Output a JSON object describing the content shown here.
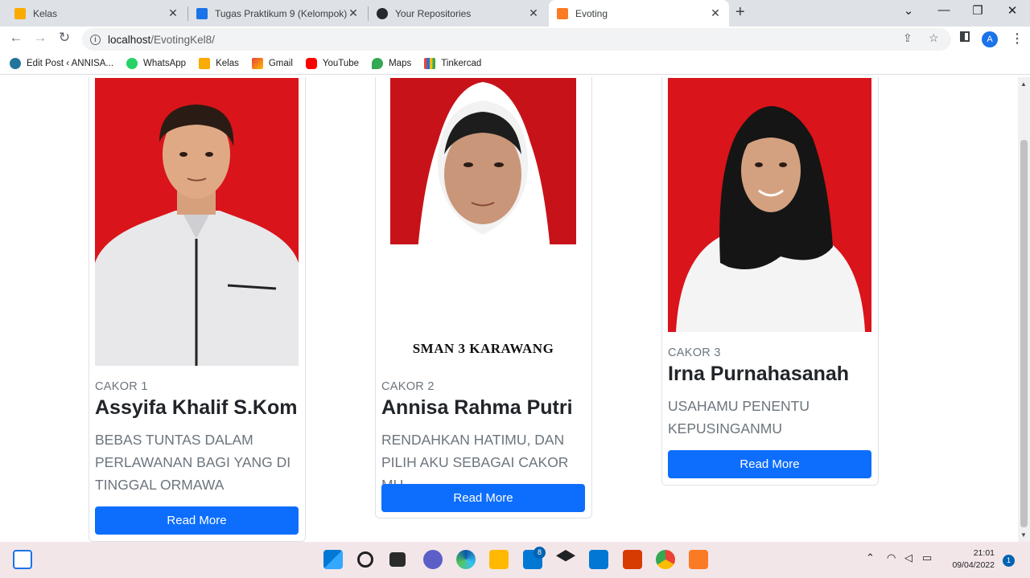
{
  "browser": {
    "tabs": [
      {
        "title": "Kelas",
        "active": false
      },
      {
        "title": "Tugas Praktikum 9 (Kelompok)",
        "active": false
      },
      {
        "title": "Your Repositories",
        "active": false
      },
      {
        "title": "Evoting",
        "active": true
      }
    ],
    "url_host": "localhost",
    "url_path": "/EvotingKel8/",
    "profile_initial": "A",
    "bookmarks": [
      "Edit Post ‹ ANNISA...",
      "WhatsApp",
      "Kelas",
      "Gmail",
      "YouTube",
      "Maps",
      "Tinkercad"
    ]
  },
  "candidates": [
    {
      "label": "CAKOR 1",
      "name": "Assyifa Khalif S.Kom",
      "motto": "BEBAS TUNTAS DALAM PERLAWANAN BAGI YANG DI TINGGAL ORMAWA",
      "button": "Read More"
    },
    {
      "label": "CAKOR 2",
      "name": "Annisa Rahma Putri",
      "motto": "RENDAHKAN HATIMU, DAN PILIH AKU SEBAGAI CAKOR MU",
      "button": "Read More",
      "photo_caption": "SMAN 3 KARAWANG"
    },
    {
      "label": "CAKOR 3",
      "name": "Irna Purnahasanah",
      "motto": "USAHAMU PENENTU KEPUSINGANMU",
      "button": "Read More"
    }
  ],
  "taskbar": {
    "time": "21:01",
    "date": "09/04/2022",
    "mail_badge": "8",
    "notification_count": "1"
  },
  "colors": {
    "primary_button": "#0d6efd",
    "photo_background": "#d9141a"
  }
}
